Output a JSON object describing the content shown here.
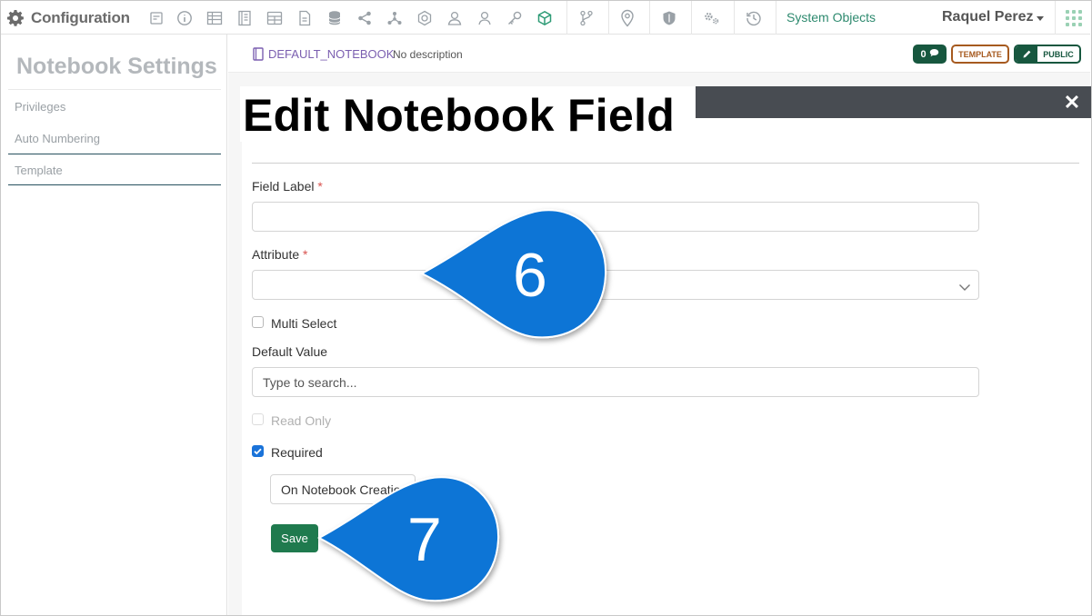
{
  "topbar": {
    "title": "Configuration",
    "icons": [
      "gear-icon",
      "report-icon",
      "info-icon",
      "table-icon",
      "form-icon",
      "grid-icon",
      "document-icon",
      "database-icon",
      "share-icon",
      "network-icon",
      "badge-icon",
      "users-icon",
      "user-icon",
      "key-icon",
      "cube-icon",
      "branch-icon",
      "location-pin-icon",
      "shield-icon",
      "settings-cogs-icon",
      "history-icon"
    ],
    "system_objects": "System Objects",
    "user_name": "Raquel Perez"
  },
  "sidebar": {
    "title": "Notebook Settings",
    "items": [
      {
        "label": "Privileges"
      },
      {
        "label": "Auto Numbering"
      },
      {
        "label": "Template"
      }
    ]
  },
  "notebook": {
    "name": "DEFAULT_NOTEBOOK",
    "description": "No description",
    "comment_count": "0",
    "template_badge": "TEMPLATE",
    "public_badge": "PUBLIC"
  },
  "modal": {
    "title": "Edit Notebook Field",
    "close_glyph": "✕",
    "field_label": {
      "label": "Field Label",
      "required_mark": "*",
      "value": ""
    },
    "attribute": {
      "label": "Attribute",
      "required_mark": "*",
      "value": ""
    },
    "multi_select": {
      "label": "Multi Select",
      "checked": false
    },
    "default_value": {
      "label": "Default Value",
      "placeholder": "Type to search..."
    },
    "read_only": {
      "label": "Read Only",
      "checked": false,
      "disabled": true
    },
    "required": {
      "label": "Required",
      "checked": true
    },
    "required_when": "On Notebook Creation",
    "save_label": "Save"
  },
  "callouts": [
    {
      "number": "6",
      "color": "#0b74d6"
    },
    {
      "number": "7",
      "color": "#0b74d6"
    }
  ],
  "colors": {
    "accent_green": "#1f7a4e",
    "purple_link": "#7b5fb0",
    "checkbox_blue": "#1a73d9",
    "modal_bar": "#484c52"
  }
}
